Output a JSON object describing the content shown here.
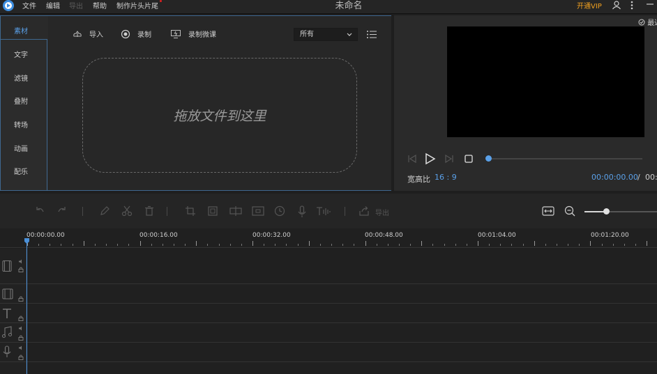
{
  "menu": {
    "items": [
      "文件",
      "编辑",
      "导出",
      "帮助",
      "制作片头片尾"
    ],
    "disabled": [
      false,
      false,
      true,
      false,
      false
    ]
  },
  "window": {
    "title": "未命名"
  },
  "account": {
    "vip_label": "开通VIP"
  },
  "sidebar": {
    "tabs": [
      "素材",
      "文字",
      "滤镜",
      "叠附",
      "转场",
      "动画",
      "配乐"
    ],
    "active_index": 0
  },
  "media": {
    "import_label": "导入",
    "record_label": "录制",
    "record_course_label": "录制微课",
    "filter_value": "所有",
    "drop_text": "拖放文件到这里"
  },
  "preview": {
    "recent_label": "最近",
    "aspect_label": "宽高比",
    "aspect_value": "16 : 9",
    "time_current": "00:00:00.00",
    "time_separator": "/",
    "time_total": "00:",
    "progress": 0
  },
  "timeline": {
    "export_label": "导出",
    "zoom_level": 0.3,
    "ruler_labels": [
      "00:00:00.00",
      "00:00:16.00",
      "00:00:32.00",
      "00:00:48.00",
      "00:01:04.00",
      "00:01:20.00"
    ]
  },
  "colors": {
    "accent": "#5aa0e8",
    "vip": "#f0a020",
    "panel_border": "#3f6890"
  }
}
